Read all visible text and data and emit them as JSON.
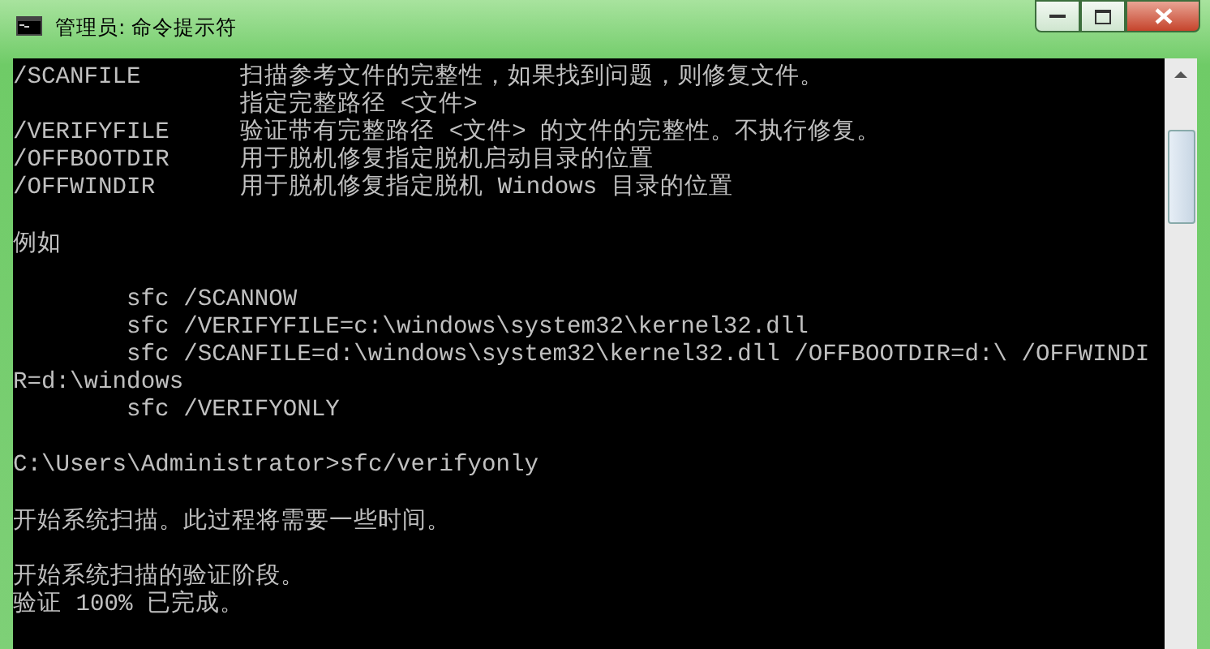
{
  "window": {
    "title": "管理员: 命令提示符"
  },
  "console": {
    "lines": [
      {
        "kind": "option",
        "option": "/SCANFILE",
        "description": "扫描参考文件的完整性，如果找到问题，则修复文件。"
      },
      {
        "kind": "continuation",
        "description": "指定完整路径 <文件>"
      },
      {
        "kind": "option",
        "option": "/VERIFYFILE",
        "description": "验证带有完整路径 <文件> 的文件的完整性。不执行修复。"
      },
      {
        "kind": "option",
        "option": "/OFFBOOTDIR",
        "description": "用于脱机修复指定脱机启动目录的位置"
      },
      {
        "kind": "option",
        "option": "/OFFWINDIR",
        "description": "用于脱机修复指定脱机 Windows 目录的位置"
      },
      {
        "kind": "blank"
      },
      {
        "kind": "text",
        "text": "例如"
      },
      {
        "kind": "blank"
      },
      {
        "kind": "example",
        "text": "sfc /SCANNOW"
      },
      {
        "kind": "example",
        "text": "sfc /VERIFYFILE=c:\\windows\\system32\\kernel32.dll"
      },
      {
        "kind": "example",
        "text": "sfc /SCANFILE=d:\\windows\\system32\\kernel32.dll /OFFBOOTDIR=d:\\ /OFFWINDI"
      },
      {
        "kind": "text",
        "text": "R=d:\\windows"
      },
      {
        "kind": "example",
        "text": "sfc /VERIFYONLY"
      },
      {
        "kind": "blank"
      },
      {
        "kind": "text",
        "text": "C:\\Users\\Administrator>sfc/verifyonly"
      },
      {
        "kind": "blank"
      },
      {
        "kind": "text",
        "text": "开始系统扫描。此过程将需要一些时间。"
      },
      {
        "kind": "blank"
      },
      {
        "kind": "text",
        "text": "开始系统扫描的验证阶段。"
      },
      {
        "kind": "text",
        "text": "验证 100% 已完成。"
      }
    ]
  }
}
